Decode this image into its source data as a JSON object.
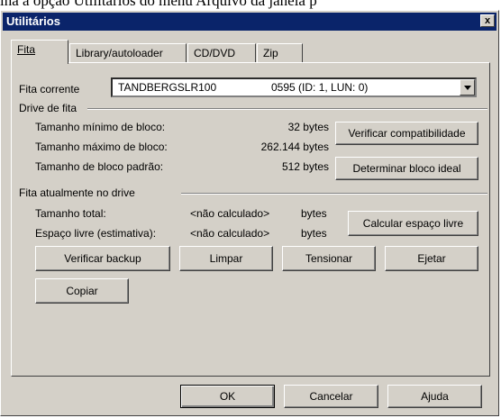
{
  "caption": "ina a opção Utilitários do menu Arquivo da janela p",
  "window": {
    "title": "Utilitários",
    "close_glyph": "x"
  },
  "tabs": [
    {
      "label": "Fita",
      "active": true
    },
    {
      "label": "Library/autoloader",
      "active": false
    },
    {
      "label": "CD/DVD",
      "active": false
    },
    {
      "label": "Zip",
      "active": false
    }
  ],
  "tape": {
    "label": "Fita corrente",
    "device": "TANDBERGSLR100",
    "info": "0595 (ID: 1, LUN: 0)"
  },
  "drive": {
    "title": "Drive de fita",
    "min_label": "Tamanho mínimo de bloco:",
    "min_value": "32 bytes",
    "max_label": "Tamanho máximo de bloco:",
    "max_value": "262.144 bytes",
    "def_label": "Tamanho de bloco padrão:",
    "def_value": "512 bytes",
    "verify_compat": "Verificar compatibilidade",
    "ideal_block": "Determinar bloco ideal"
  },
  "current": {
    "title": "Fita atualmente no drive",
    "total_label": "Tamanho total:",
    "total_value": "<não calculado>",
    "total_unit": "bytes",
    "free_label": "Espaço livre (estimativa):",
    "free_value": "<não calculado>",
    "free_unit": "bytes",
    "calc_free": "Calcular espaço livre"
  },
  "actions": {
    "verify_backup": "Verificar backup",
    "clean": "Limpar",
    "tension": "Tensionar",
    "eject": "Ejetar",
    "copy": "Copiar"
  },
  "footer": {
    "ok": "OK",
    "cancel": "Cancelar",
    "help": "Ajuda"
  },
  "colors": {
    "face": "#d4d0c8",
    "titlebar": "#0a246a"
  }
}
